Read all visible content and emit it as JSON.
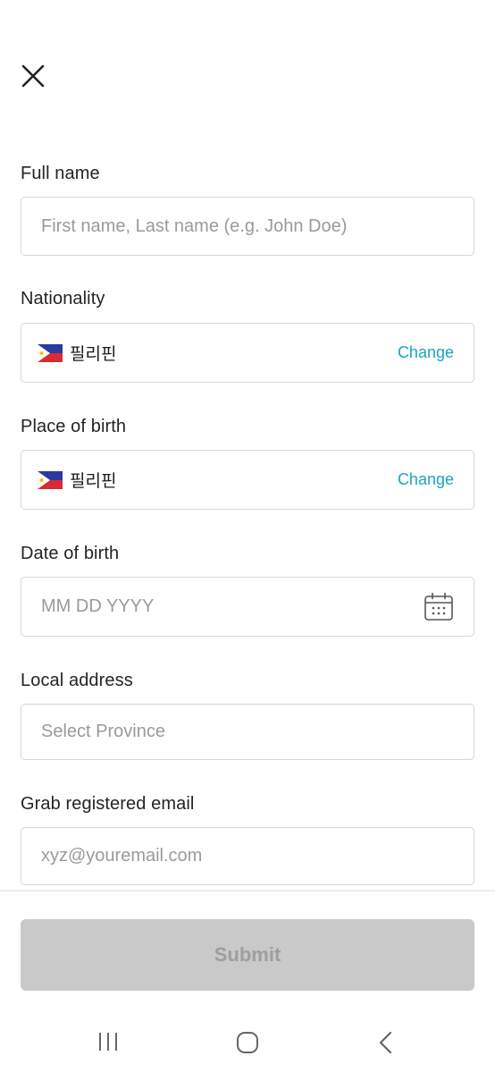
{
  "form": {
    "full_name": {
      "label": "Full name",
      "placeholder": "First name, Last name (e.g. John Doe)"
    },
    "nationality": {
      "label": "Nationality",
      "value": "필리핀",
      "action": "Change",
      "flag": "philippines-flag-icon"
    },
    "place_of_birth": {
      "label": "Place of birth",
      "value": "필리핀",
      "action": "Change",
      "flag": "philippines-flag-icon"
    },
    "date_of_birth": {
      "label": "Date of birth",
      "placeholder": "MM DD YYYY",
      "icon": "calendar-icon"
    },
    "local_address": {
      "label": "Local address",
      "placeholder": "Select Province"
    },
    "grab_email": {
      "label": "Grab registered email",
      "placeholder": "xyz@youremail.com"
    }
  },
  "submit_label": "Submit",
  "colors": {
    "link": "#1aa3c4",
    "disabled_button": "#c9c9c9",
    "border": "#d6d6d6"
  },
  "icons": {
    "close": "close-icon",
    "nav_recent": "recent-apps-icon",
    "nav_home": "home-icon",
    "nav_back": "back-icon"
  }
}
